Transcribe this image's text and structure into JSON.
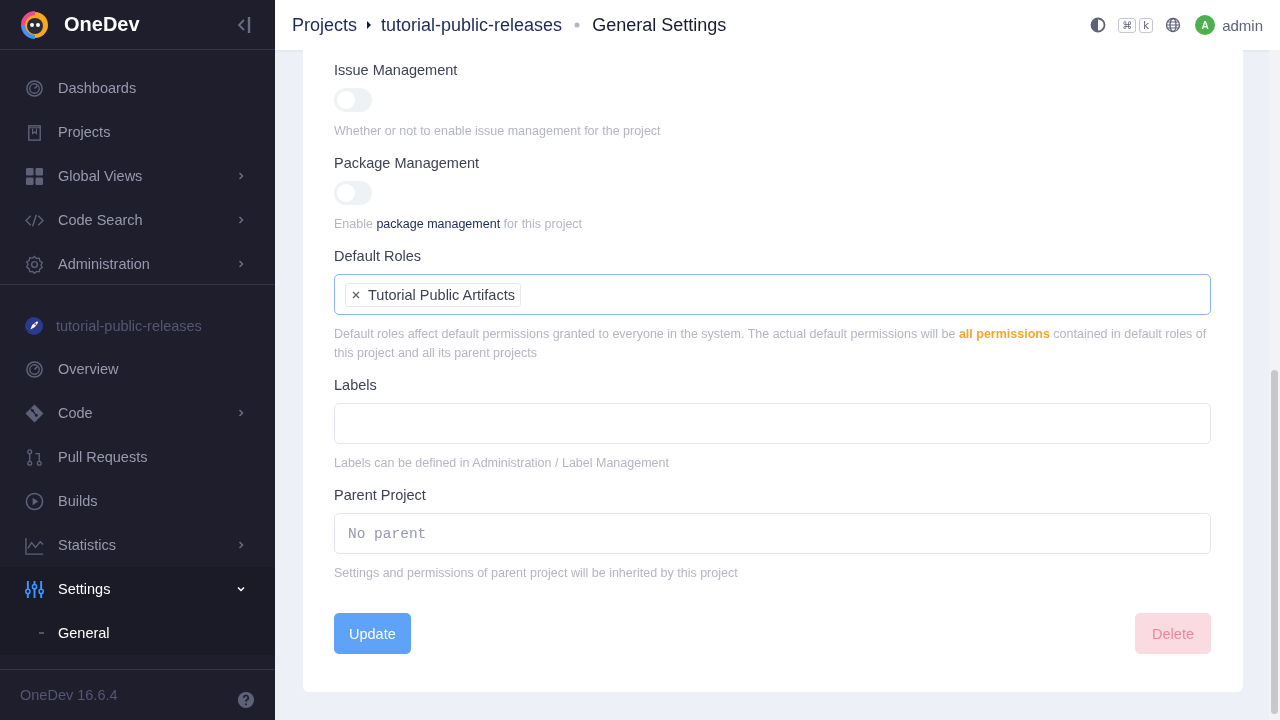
{
  "brand": {
    "name": "OneDev"
  },
  "global_nav": [
    {
      "label": "Dashboards",
      "selected": false
    },
    {
      "label": "Projects",
      "selected": false
    },
    {
      "label": "Global Views",
      "selected": false,
      "expanded": false
    },
    {
      "label": "Code Search",
      "selected": false,
      "expanded": false
    },
    {
      "label": "Administration",
      "selected": false,
      "expanded": false
    }
  ],
  "project": {
    "name": "tutorial-public-releases"
  },
  "project_nav": [
    {
      "label": "Overview",
      "selected": false
    },
    {
      "label": "Code",
      "selected": false,
      "expanded": false
    },
    {
      "label": "Pull Requests",
      "selected": false
    },
    {
      "label": "Builds",
      "selected": false
    },
    {
      "label": "Statistics",
      "selected": false,
      "expanded": false
    },
    {
      "label": "Settings",
      "selected": true,
      "expanded": true,
      "children": [
        {
          "label": "General",
          "selected": true
        }
      ]
    }
  ],
  "footer": {
    "version": "OneDev 16.6.4"
  },
  "breadcrumb": {
    "root": "Projects",
    "project": "tutorial-public-releases",
    "page": "General Settings"
  },
  "topbar": {
    "shortcut_keys": [
      "⌘",
      "k"
    ],
    "avatar_letter": "A",
    "user": "admin"
  },
  "fields": [
    {
      "kind": "toggle",
      "label": "Issue Management",
      "on": false,
      "help": [
        {
          "text": "Whether or not to enable issue management for the project"
        }
      ]
    },
    {
      "kind": "toggle",
      "label": "Package Management",
      "on": false,
      "help": [
        {
          "text": "Enable "
        },
        {
          "text": "package management",
          "link": true
        },
        {
          "text": " for this project"
        }
      ]
    },
    {
      "kind": "tags",
      "label": "Default Roles",
      "focused": true,
      "tags": [
        "Tutorial Public Artifacts"
      ],
      "help": [
        {
          "text": "Default roles affect default permissions granted to everyone in the system. The actual default permissions will be "
        },
        {
          "text": "all permissions",
          "strong": true
        },
        {
          "text": " contained in default roles of this project and all its parent projects"
        }
      ]
    },
    {
      "kind": "tags",
      "label": "Labels",
      "focused": false,
      "help": [
        {
          "text": "Labels can be defined in Administration / Label Management"
        }
      ]
    },
    {
      "kind": "select",
      "label": "Parent Project",
      "placeholder": "No parent",
      "help": [
        {
          "text": "Settings and permissions of parent project will be inherited by this project"
        }
      ]
    }
  ],
  "actions": {
    "update": "Update",
    "delete": "Delete"
  }
}
